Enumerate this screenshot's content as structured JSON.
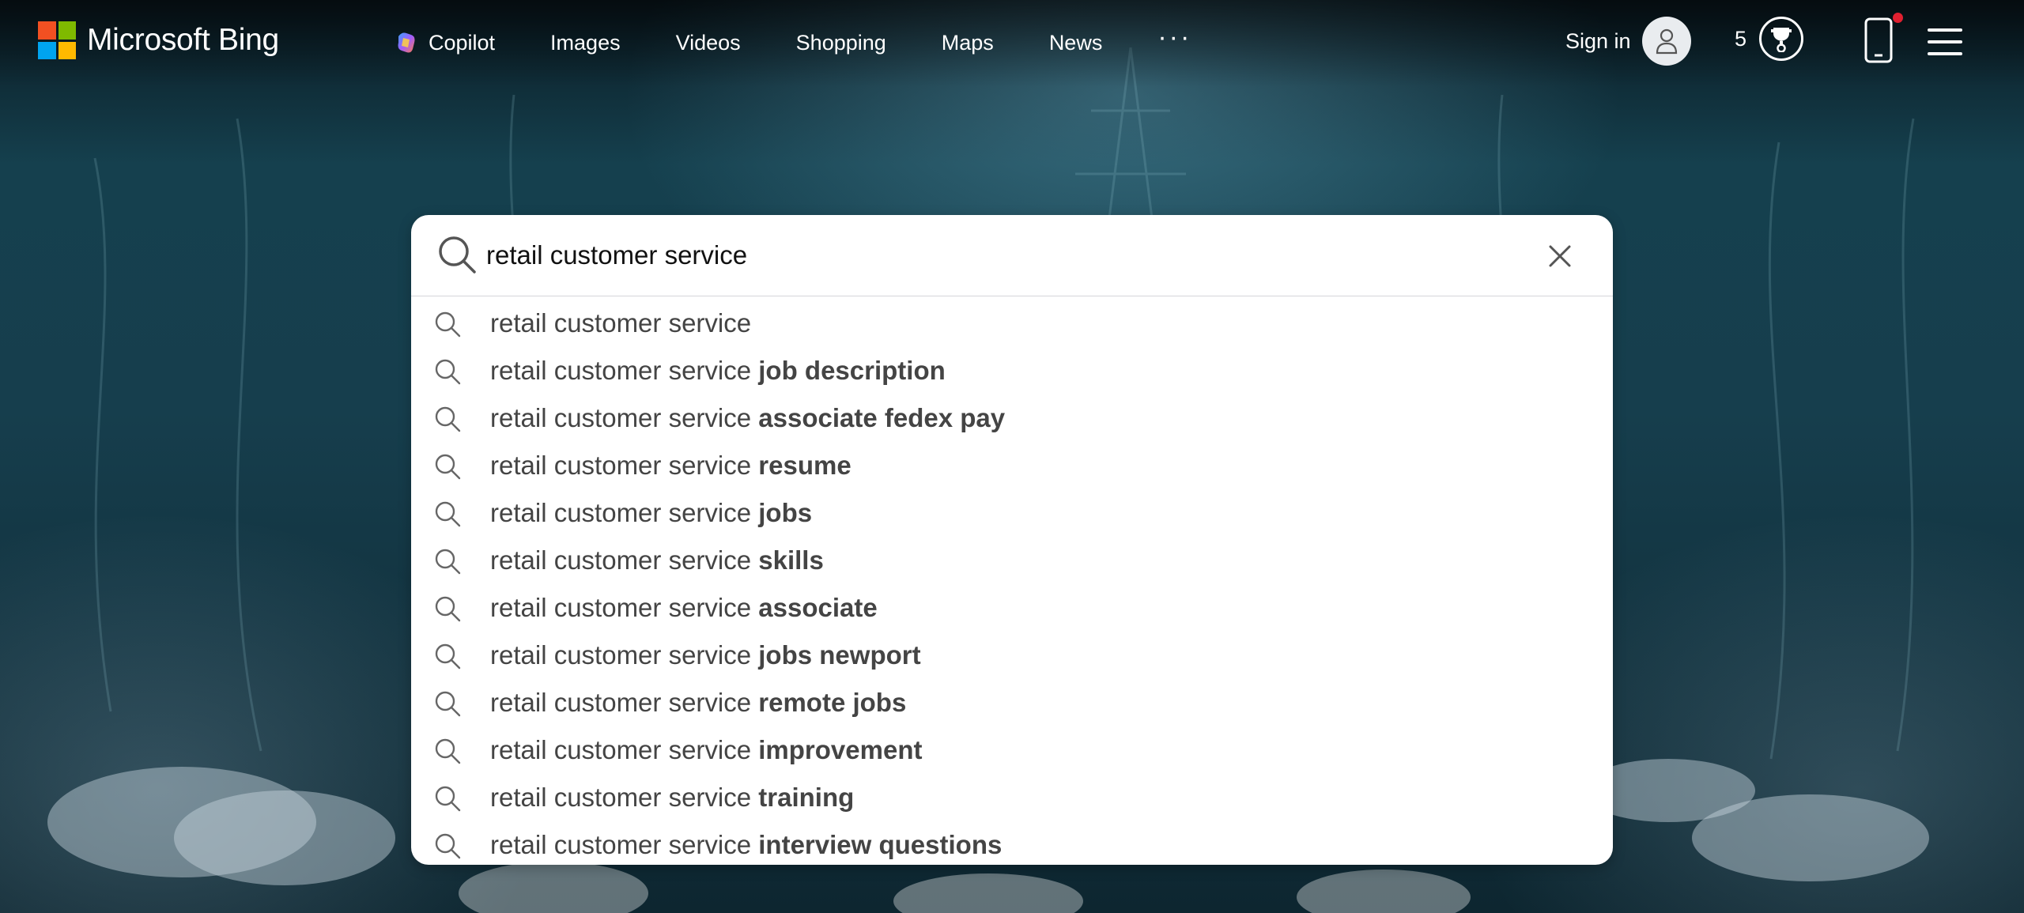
{
  "header": {
    "logo_text": "Microsoft Bing",
    "nav": [
      {
        "id": "copilot",
        "label": "Copilot"
      },
      {
        "id": "images",
        "label": "Images"
      },
      {
        "id": "videos",
        "label": "Videos"
      },
      {
        "id": "shopping",
        "label": "Shopping"
      },
      {
        "id": "maps",
        "label": "Maps"
      },
      {
        "id": "news",
        "label": "News"
      }
    ],
    "more_label": "···",
    "signin_label": "Sign in",
    "rewards_count": "5"
  },
  "search": {
    "value": "retail customer service",
    "suggestions": [
      {
        "base": "retail customer service",
        "bold": ""
      },
      {
        "base": "retail customer service ",
        "bold": "job description"
      },
      {
        "base": "retail customer service ",
        "bold": "associate fedex pay"
      },
      {
        "base": "retail customer service ",
        "bold": "resume"
      },
      {
        "base": "retail customer service ",
        "bold": "jobs"
      },
      {
        "base": "retail customer service ",
        "bold": "skills"
      },
      {
        "base": "retail customer service ",
        "bold": "associate"
      },
      {
        "base": "retail customer service ",
        "bold": "jobs newport"
      },
      {
        "base": "retail customer service ",
        "bold": "remote jobs"
      },
      {
        "base": "retail customer service ",
        "bold": "improvement"
      },
      {
        "base": "retail customer service ",
        "bold": "training"
      },
      {
        "base": "retail customer service ",
        "bold": "interview questions"
      }
    ]
  },
  "colors": {
    "ms_red": "#f25022",
    "ms_green": "#7fba00",
    "ms_blue": "#00a4ef",
    "ms_yellow": "#ffb900",
    "notification_dot": "#e02030"
  },
  "icons": {
    "logo": "microsoft-logo-icon",
    "copilot": "copilot-icon",
    "avatar": "user-icon",
    "rewards": "trophy-icon",
    "phone": "phone-icon",
    "menu": "hamburger-icon",
    "search": "search-icon",
    "clear": "close-icon"
  }
}
